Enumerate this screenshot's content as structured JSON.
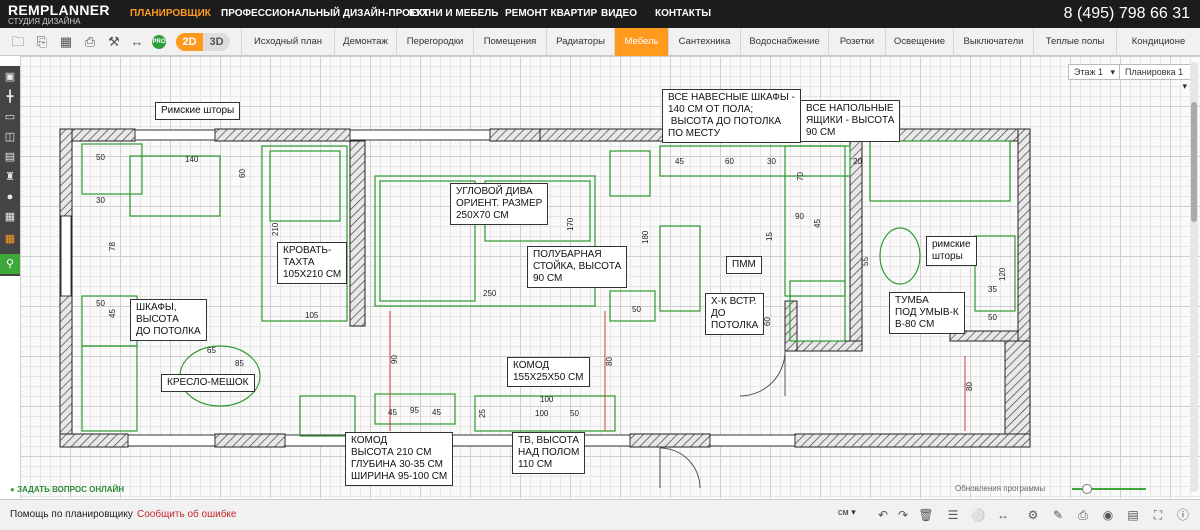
{
  "header": {
    "logo_main": "REMPLANNER",
    "logo_sub": "СТУДИЯ ДИЗАЙНА",
    "nav": [
      "ПЛАНИРОВЩИК",
      "ПРОФЕССИОНАЛЬНЫЙ ДИЗАЙН-ПРОЕКТ",
      "КУХНИ И МЕБЕЛЬ",
      "РЕМОНТ КВАРТИР",
      "ВИДЕО",
      "КОНТАКТЫ"
    ],
    "active_nav": "ПЛАНИРОВЩИК",
    "phone": "8 (495) 798 66 31",
    "accent": "#ff9a1f"
  },
  "toolbar": {
    "pro_badge": "PRO",
    "mode_2d": "2D",
    "mode_3d": "3D",
    "tabs": [
      "Исходный план",
      "Демонтаж",
      "Перегородки",
      "Помещения",
      "Радиаторы",
      "Мебель",
      "Сантехника",
      "Водоснабжение",
      "Розетки",
      "Освещение",
      "Выключатели",
      "Теплые полы",
      "Кондиционе"
    ],
    "active_tab": "Мебель",
    "icons": [
      "folder-icon",
      "save-icon",
      "pdf-icon",
      "print-icon",
      "tools-icon",
      "share-icon",
      "dimensions-icon",
      "pro-icon"
    ]
  },
  "canvas": {
    "floor_select": "Этаж 1",
    "layout_select": "Планировка 1",
    "notes": {
      "roman_blinds": "Римские шторы",
      "wall_cabinets": "ВСЕ НАВЕСНЫЕ ШКАФЫ -\n140 СМ ОТ ПОЛА;\n ВЫСОТА ДО ПОТОЛКА\nПО МЕСТУ",
      "floor_drawers": "ВСЕ НАПОЛЬНЫЕ\nЯЩИКИ - ВЫСОТА\n90 СМ",
      "corner_sofa": "УГЛОВОЙ ДИВА\nОРИЕНТ. РАЗМЕР\n250Х70 СМ",
      "bed_sofa": "КРОВАТЬ-\nТАХТА\n105Х210 СМ",
      "bar_counter": "ПОЛУБАРНАЯ\nСТОЙКА, ВЫСОТА\n90 СМ",
      "dishwasher": "ПММ",
      "fridge": "Х-К ВСТР.\nДО\nПОТОЛКА",
      "roman_blinds_small": "римские\nшторы",
      "vanity": "ТУМБА\nПОД УМЫВ-К\nВ-80 СМ",
      "wardrobes": "ШКАФЫ,\nВЫСОТА\nДО ПОТОЛКА",
      "beanbag": "КРЕСЛО-МЕШОК",
      "commode_small": "КОМОД\n155Х25Х50 СМ",
      "commode_big": "КОМОД\nВЫСОТА 210 СМ\nГЛУБИНА 30-35 СМ\nШИРИНА 95-100 СМ",
      "tv": "ТВ, ВЫСОТА\nНАД ПОЛОМ\n110 СМ"
    },
    "dimensions": [
      "140",
      "60",
      "50",
      "210",
      "105",
      "250",
      "170",
      "180",
      "50",
      "45",
      "60",
      "30",
      "90",
      "70",
      "55",
      "120",
      "35",
      "50",
      "100",
      "90",
      "80",
      "80",
      "45",
      "95",
      "45",
      "25",
      "100",
      "50",
      "78",
      "30",
      "50",
      "45",
      "65",
      "85",
      "60",
      "15",
      "20",
      "45"
    ]
  },
  "footer": {
    "help_online": "ЗАДАТЬ ВОПРОС ОНЛАЙН",
    "updates": "Обновления программы",
    "help_link": "Помощь по планировщику",
    "report_link": "Сообщить об ошибке",
    "unit": "см",
    "zoom_level": 0.15
  }
}
